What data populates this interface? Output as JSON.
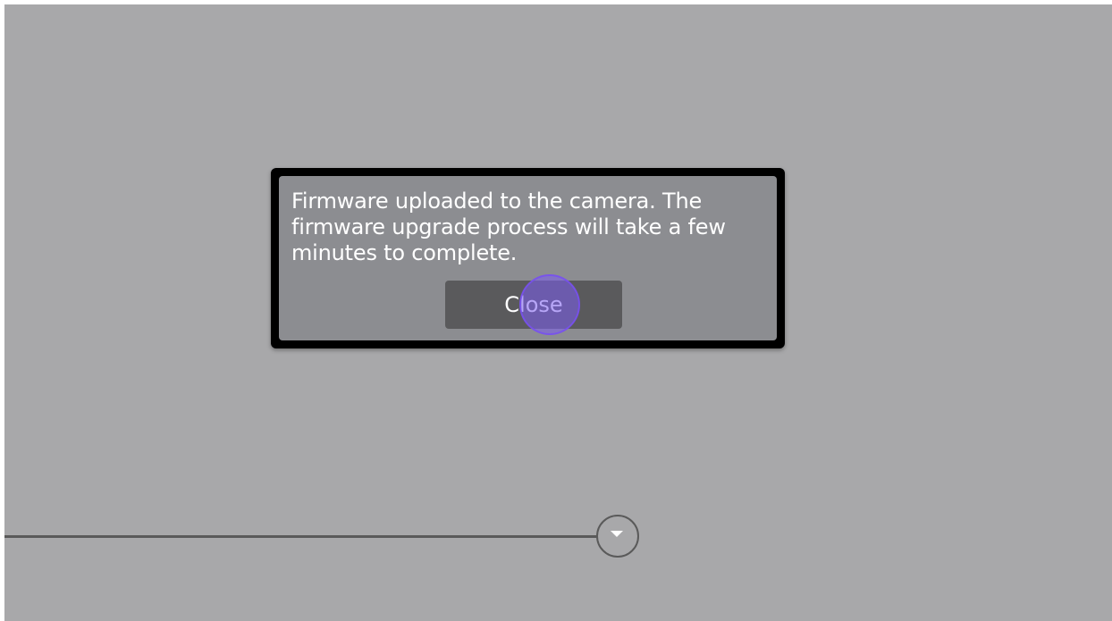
{
  "dialog": {
    "message": "Firmware uploaded to the camera. The firmware upgrade process will take a few minutes to complete.",
    "close_label": "Close"
  },
  "timeline": {
    "handle_icon": "chevron-down-icon"
  },
  "colors": {
    "background": "#a8a8aa",
    "dialog_border": "#000000",
    "dialog_fill": "#8c8d91",
    "button_fill": "#5a5a5c",
    "click_indicator": "#7c5cf0"
  }
}
